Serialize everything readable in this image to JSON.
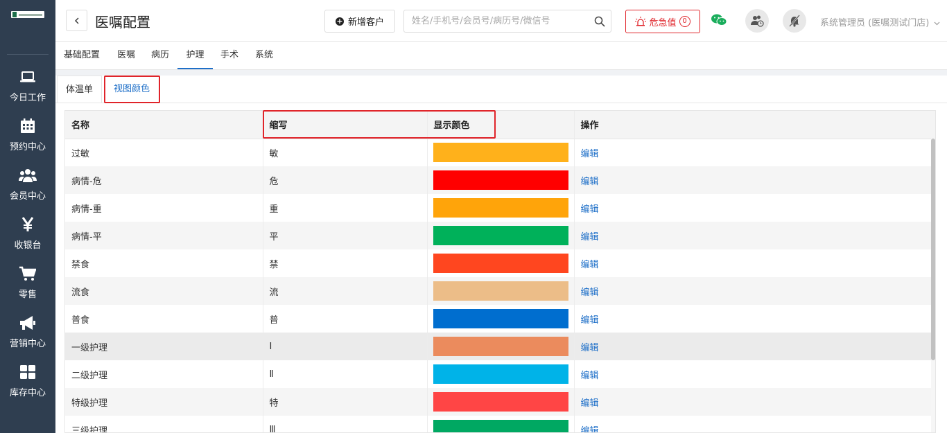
{
  "sidebar": {
    "items": [
      {
        "label": "今日工作",
        "icon": "laptop-icon"
      },
      {
        "label": "预约中心",
        "icon": "calendar-icon"
      },
      {
        "label": "会员中心",
        "icon": "users-icon"
      },
      {
        "label": "收银台",
        "icon": "yen-icon"
      },
      {
        "label": "零售",
        "icon": "cart-icon"
      },
      {
        "label": "营销中心",
        "icon": "megaphone-icon"
      },
      {
        "label": "库存中心",
        "icon": "grid-icon"
      }
    ]
  },
  "header": {
    "title": "医嘱配置",
    "add_customer": "新增客户",
    "search_placeholder": "姓名/手机号/会员号/病历号/微信号",
    "danger_label": "危急值",
    "danger_count": "0",
    "user": "系统管理员 (医嘱测试门店)"
  },
  "tabs": [
    "基础配置",
    "医嘱",
    "病历",
    "护理",
    "手术",
    "系统"
  ],
  "active_tab": "护理",
  "subtabs": [
    "体温单",
    "视图颜色"
  ],
  "active_subtab": "视图颜色",
  "table": {
    "columns": [
      "名称",
      "缩写",
      "显示颜色",
      "操作"
    ],
    "rows": [
      {
        "name": "过敏",
        "abbr": "敏",
        "color": "#ffb11b",
        "action": "编辑"
      },
      {
        "name": "病情-危",
        "abbr": "危",
        "color": "#ff0000",
        "action": "编辑"
      },
      {
        "name": "病情-重",
        "abbr": "重",
        "color": "#ffa40a",
        "action": "编辑"
      },
      {
        "name": "病情-平",
        "abbr": "平",
        "color": "#00b15a",
        "action": "编辑"
      },
      {
        "name": "禁食",
        "abbr": "禁",
        "color": "#ff461f",
        "action": "编辑"
      },
      {
        "name": "流食",
        "abbr": "流",
        "color": "#ecbd88",
        "action": "编辑"
      },
      {
        "name": "普食",
        "abbr": "普",
        "color": "#006ecf",
        "action": "编辑"
      },
      {
        "name": "一级护理",
        "abbr": "Ⅰ",
        "color": "#eb8b5d",
        "action": "编辑"
      },
      {
        "name": "二级护理",
        "abbr": "Ⅱ",
        "color": "#00b3e8",
        "action": "编辑"
      },
      {
        "name": "特级护理",
        "abbr": "特",
        "color": "#ff4545",
        "action": "编辑"
      },
      {
        "name": "三级护理",
        "abbr": "Ⅲ",
        "color": "#00a862",
        "action": "编辑"
      }
    ]
  }
}
